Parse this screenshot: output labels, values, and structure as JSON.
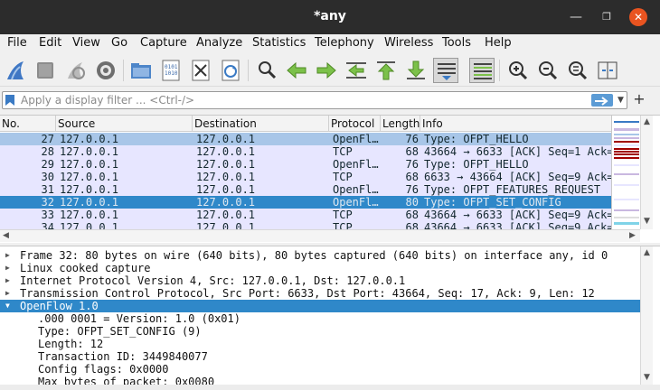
{
  "window": {
    "title": "*any"
  },
  "menu": [
    "File",
    "Edit",
    "View",
    "Go",
    "Capture",
    "Analyze",
    "Statistics",
    "Telephony",
    "Wireless",
    "Tools",
    "Help"
  ],
  "toolbar": {
    "icons": [
      "shark-fin-start-icon",
      "stop-icon",
      "restart-icon",
      "capture-options-icon",
      "open-folder-icon",
      "save-file-icon",
      "close-file-icon",
      "reload-icon",
      "find-icon",
      "back-icon",
      "forward-icon",
      "go-to-packet-icon",
      "first-packet-icon",
      "last-packet-icon",
      "autoscroll-icon",
      "colorize-icon",
      "zoom-in-icon",
      "zoom-out-icon",
      "zoom-normal-icon",
      "resize-columns-icon"
    ]
  },
  "filter": {
    "placeholder": "Apply a display filter ... <Ctrl-/>",
    "add_label": "+"
  },
  "packet_list": {
    "columns": [
      "No.",
      "Source",
      "Destination",
      "Protocol",
      "Length",
      "Info"
    ],
    "rows": [
      {
        "no": "27",
        "src": "127.0.0.1",
        "dst": "127.0.0.1",
        "proto": "OpenFl…",
        "len": "76",
        "info": "Type: OFPT_HELLO",
        "style": "marked"
      },
      {
        "no": "28",
        "src": "127.0.0.1",
        "dst": "127.0.0.1",
        "proto": "TCP",
        "len": "68",
        "info": "43664 → 6633 [ACK] Seq=1 Ack=",
        "style": "tcp"
      },
      {
        "no": "29",
        "src": "127.0.0.1",
        "dst": "127.0.0.1",
        "proto": "OpenFl…",
        "len": "76",
        "info": "Type: OFPT_HELLO",
        "style": "hello"
      },
      {
        "no": "30",
        "src": "127.0.0.1",
        "dst": "127.0.0.1",
        "proto": "TCP",
        "len": "68",
        "info": "6633 → 43664 [ACK] Seq=9 Ack=",
        "style": "tcp"
      },
      {
        "no": "31",
        "src": "127.0.0.1",
        "dst": "127.0.0.1",
        "proto": "OpenFl…",
        "len": "76",
        "info": "Type: OFPT_FEATURES_REQUEST",
        "style": "hello"
      },
      {
        "no": "32",
        "src": "127.0.0.1",
        "dst": "127.0.0.1",
        "proto": "OpenFl…",
        "len": "80",
        "info": "Type: OFPT_SET_CONFIG",
        "style": "selected"
      },
      {
        "no": "33",
        "src": "127.0.0.1",
        "dst": "127.0.0.1",
        "proto": "TCP",
        "len": "68",
        "info": "43664 → 6633 [ACK] Seq=9 Ack=",
        "style": "tcp"
      },
      {
        "no": "34",
        "src": "127.0.0.1",
        "dst": "127.0.0.1",
        "proto": "TCP",
        "len": "68",
        "info": "43664 → 6633 [ACK] Seq=9 Ack=",
        "style": "tcp"
      }
    ]
  },
  "details": [
    {
      "text": "Frame 32: 80 bytes on wire (640 bits), 80 bytes captured (640 bits) on interface any, id 0",
      "expander": "collapsed",
      "indent": 0,
      "selected": false
    },
    {
      "text": "Linux cooked capture",
      "expander": "collapsed",
      "indent": 0,
      "selected": false
    },
    {
      "text": "Internet Protocol Version 4, Src: 127.0.0.1, Dst: 127.0.0.1",
      "expander": "collapsed",
      "indent": 0,
      "selected": false
    },
    {
      "text": "Transmission Control Protocol, Src Port: 6633, Dst Port: 43664, Seq: 17, Ack: 9, Len: 12",
      "expander": "collapsed",
      "indent": 0,
      "selected": false
    },
    {
      "text": "OpenFlow 1.0",
      "expander": "expanded",
      "indent": 0,
      "selected": true
    },
    {
      "text": ".000 0001 = Version: 1.0 (0x01)",
      "expander": "none",
      "indent": 1,
      "selected": false
    },
    {
      "text": "Type: OFPT_SET_CONFIG (9)",
      "expander": "none",
      "indent": 1,
      "selected": false
    },
    {
      "text": "Length: 12",
      "expander": "none",
      "indent": 1,
      "selected": false
    },
    {
      "text": "Transaction ID: 3449840077",
      "expander": "none",
      "indent": 1,
      "selected": false
    },
    {
      "text": "Config flags: 0x0000",
      "expander": "none",
      "indent": 1,
      "selected": false
    },
    {
      "text": "Max bytes of packet: 0x0080",
      "expander": "none",
      "indent": 1,
      "selected": false
    }
  ],
  "colors": {
    "selected": "#2f88c9",
    "marked": "#a8c6e8",
    "openflow_row": "#e7e6ff",
    "close_button": "#e95420"
  }
}
